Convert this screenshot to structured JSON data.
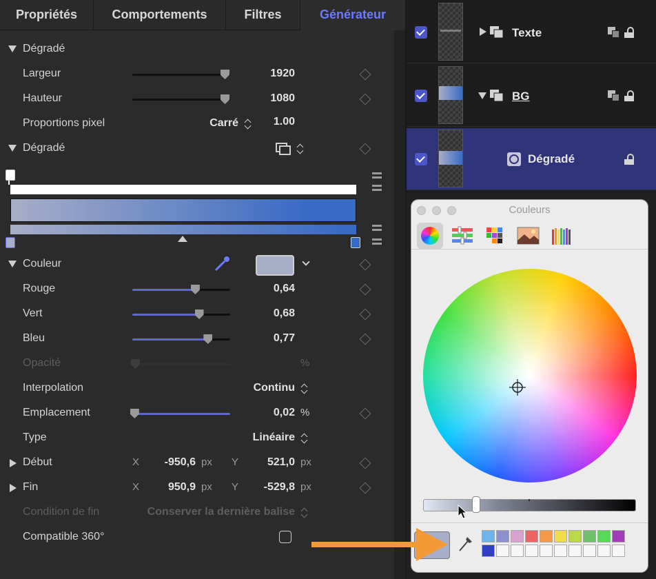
{
  "tabs": [
    "Propriétés",
    "Comportements",
    "Filtres",
    "Générateur"
  ],
  "active_tab": "Générateur",
  "inspector": {
    "section_gradient": "Dégradé",
    "width_label": "Largeur",
    "width_value": "1920",
    "width_level": 0.95,
    "height_label": "Hauteur",
    "height_value": "1080",
    "height_level": 0.95,
    "pixel_aspect_label": "Proportions pixel",
    "pixel_aspect_choice": "Carré",
    "pixel_aspect_value": "1.00",
    "gradient_label": "Dégradé",
    "color_label": "Couleur",
    "color_swatch": "#a7aec7",
    "red_label": "Rouge",
    "red_value": "0,64",
    "red_level": 0.64,
    "green_label": "Vert",
    "green_value": "0,68",
    "green_level": 0.68,
    "blue_label": "Bleu",
    "blue_value": "0,77",
    "blue_level": 0.77,
    "opacity_label": "Opacité",
    "opacity_unit": "%",
    "interpolation_label": "Interpolation",
    "interpolation_value": "Continu",
    "location_label": "Emplacement",
    "location_value": "0,02",
    "location_unit": "%",
    "location_level": 0.02,
    "type_label": "Type",
    "type_value": "Linéaire",
    "start_label": "Début",
    "start_x": "-950,6",
    "start_y": "521,0",
    "end_label": "Fin",
    "end_x": "950,9",
    "end_y": "-529,8",
    "axis_x": "X",
    "axis_y": "Y",
    "unit_px": "px",
    "end_condition_label": "Condition de fin",
    "end_condition_value": "Conserver la dernière balise",
    "compat360_label": "Compatible 360°",
    "gradient_start_color": "#a7aec7",
    "gradient_end_color": "#3a6bc4"
  },
  "layers": [
    {
      "name": "Texte",
      "checked": true
    },
    {
      "name": "BG",
      "checked": true
    },
    {
      "name": "Dégradé",
      "checked": true,
      "selected": true
    }
  ],
  "colors_panel": {
    "title": "Couleurs",
    "brightness_level": 0.25,
    "current_color": "#a7aec7",
    "swatches_row1": [
      "#6fb3e8",
      "#8c8fd0",
      "#d9a3cf",
      "#ec6464",
      "#f2994a",
      "#f3dc4a",
      "#b9d84a",
      "#6fbf6b",
      "#56d957",
      "#a23fb8"
    ],
    "swatches_row2": [
      "#2f3fc4",
      "",
      "",
      "",
      "",
      "",
      "",
      "",
      "",
      ""
    ]
  },
  "annotation": {
    "arrow_color": "#f29a36"
  }
}
